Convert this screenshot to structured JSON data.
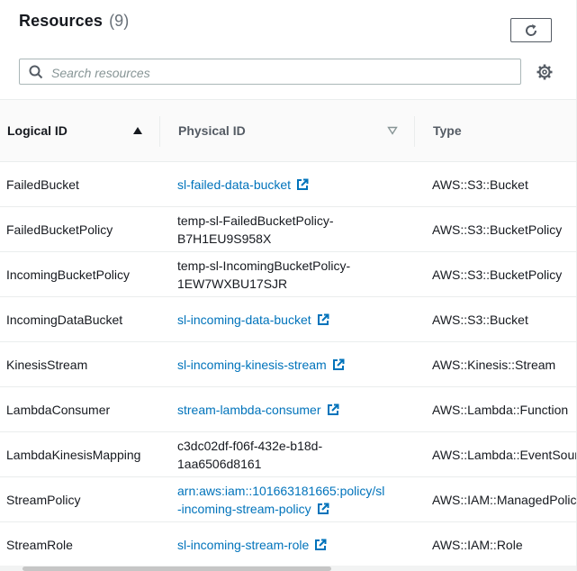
{
  "header": {
    "title": "Resources",
    "count": "(9)",
    "refresh_icon": "refresh-icon",
    "settings_icon": "gear-icon"
  },
  "search": {
    "placeholder": "Search resources",
    "value": "",
    "icon": "search-icon"
  },
  "columns": {
    "logical_id": "Logical ID",
    "physical_id": "Physical ID",
    "type": "Type",
    "logical_sort": "ascending",
    "physical_sort": "none"
  },
  "rows": [
    {
      "logical": "FailedBucket",
      "physical": "sl-failed-data-bucket",
      "physical_line2": "",
      "link": true,
      "type": "AWS::S3::Bucket"
    },
    {
      "logical": "FailedBucketPolicy",
      "physical": "temp-sl-FailedBucketPolicy-",
      "physical_line2": "B7H1EU9S958X",
      "link": false,
      "type": "AWS::S3::BucketPolicy"
    },
    {
      "logical": "IncomingBucketPolicy",
      "physical": "temp-sl-IncomingBucketPolicy-",
      "physical_line2": "1EW7WXBU17SJR",
      "link": false,
      "type": "AWS::S3::BucketPolicy"
    },
    {
      "logical": "IncomingDataBucket",
      "physical": "sl-incoming-data-bucket",
      "physical_line2": "",
      "link": true,
      "type": "AWS::S3::Bucket"
    },
    {
      "logical": "KinesisStream",
      "physical": "sl-incoming-kinesis-stream",
      "physical_line2": "",
      "link": true,
      "type": "AWS::Kinesis::Stream"
    },
    {
      "logical": "LambdaConsumer",
      "physical": "stream-lambda-consumer",
      "physical_line2": "",
      "link": true,
      "type": "AWS::Lambda::Function"
    },
    {
      "logical": "LambdaKinesisMapping",
      "physical": "c3dc02df-f06f-432e-b18d-",
      "physical_line2": "1aa6506d8161",
      "link": false,
      "type": "AWS::Lambda::EventSourceMapping"
    },
    {
      "logical": "StreamPolicy",
      "physical": "arn:aws:iam::101663181665:policy/sl",
      "physical_line2": "-incoming-stream-policy",
      "link": true,
      "type": "AWS::IAM::ManagedPolicy"
    },
    {
      "logical": "StreamRole",
      "physical": "sl-incoming-stream-role",
      "physical_line2": "",
      "link": true,
      "type": "AWS::IAM::Role"
    }
  ],
  "colors": {
    "link": "#0073bb",
    "text": "#16191f",
    "border": "#eaeded"
  }
}
